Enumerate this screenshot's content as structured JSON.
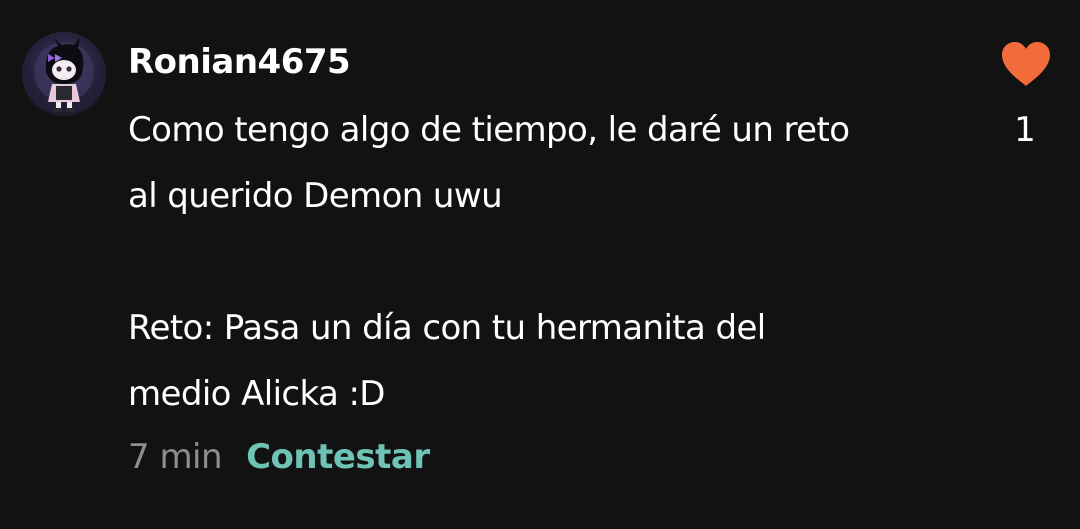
{
  "comment": {
    "username": "Ronian4675",
    "body_lines": [
      "Como tengo algo de tiempo, le daré un reto",
      "al querido Demon uwu",
      "",
      "Reto: Pasa un día con tu hermanita del",
      "medio Alicka :D"
    ],
    "time_ago": "7 min",
    "reply_label": "Contestar",
    "like_count": "1",
    "like_icon": "heart-icon",
    "colors": {
      "background": "#121212",
      "heart": "#f26b3a",
      "reply": "#6fc3b6",
      "time": "#8e8e8e"
    }
  }
}
